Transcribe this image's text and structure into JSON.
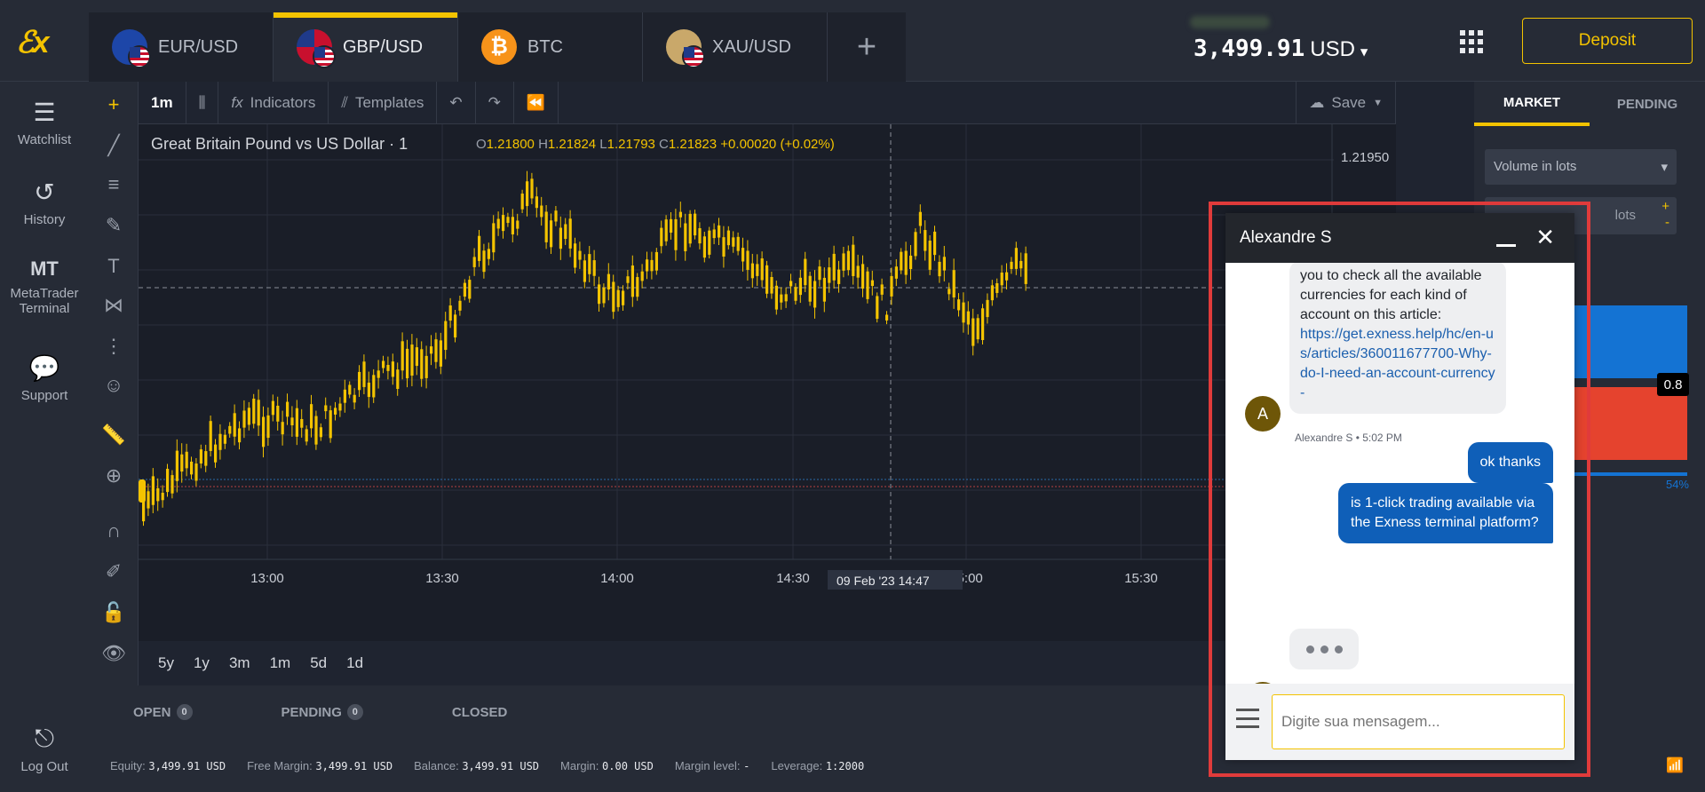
{
  "header": {
    "tabs": [
      {
        "label": "EUR/USD",
        "icon": "eur-usd-flag-icon"
      },
      {
        "label": "GBP/USD",
        "icon": "gbp-usd-flag-icon"
      },
      {
        "label": "BTC",
        "icon": "btc-icon"
      },
      {
        "label": "XAU/USD",
        "icon": "xau-usd-flag-icon"
      }
    ],
    "balance": "3,499.91",
    "currency": "USD",
    "deposit_label": "Deposit"
  },
  "leftnav": {
    "items": [
      {
        "label": "Watchlist"
      },
      {
        "label": "History"
      },
      {
        "label": "MetaTrader Terminal",
        "short": "MT"
      },
      {
        "label": "Support"
      }
    ],
    "logout_label": "Log Out"
  },
  "chart_toolbar": {
    "timeframe": "1m",
    "indicators_label": "Indicators",
    "templates_label": "Templates",
    "save_label": "Save"
  },
  "chart_header": {
    "title": "Great Britain Pound vs US Dollar",
    "interval": "1",
    "open": "1.21800",
    "high": "1.21824",
    "low": "1.21793",
    "close": "1.21823",
    "change": "+0.00020 (+0.02%)"
  },
  "chart_data": {
    "type": "candlestick",
    "x_ticks": [
      "13:00",
      "13:30",
      "14:00",
      "14:30",
      "15:00",
      "15:30"
    ],
    "crosshair_label": "09 Feb '23  14:47",
    "y_ticks": [
      "1.21950"
    ]
  },
  "timeframes": [
    "5y",
    "1y",
    "3m",
    "1m",
    "5d",
    "1d"
  ],
  "right_panel": {
    "tabs": [
      "MARKET",
      "PENDING"
    ],
    "volume_label": "Volume in lots",
    "lots_label": "lots",
    "spread": "0.8",
    "percent": "54%"
  },
  "bottom_tabs": [
    {
      "label": "OPEN",
      "count": "0"
    },
    {
      "label": "PENDING",
      "count": "0"
    },
    {
      "label": "CLOSED"
    }
  ],
  "status": {
    "equity_label": "Equity:",
    "equity": "3,499.91 USD",
    "free_margin_label": "Free Margin:",
    "free_margin": "3,499.91 USD",
    "balance_label": "Balance:",
    "balance": "3,499.91 USD",
    "margin_label": "Margin:",
    "margin": "0.00 USD",
    "margin_level_label": "Margin level:",
    "margin_level": "-",
    "leverage_label": "Leverage:",
    "leverage": "1:2000"
  },
  "chat": {
    "agent_name": "Alexandre S",
    "avatar_letter": "A",
    "agent_message_text": "you to check all the available currencies for each kind of account on this article:",
    "agent_message_link": "https://get.exness.help/hc/en-us/articles/360011677700-Why-do-I-need-an-account-currency-",
    "agent_meta": "Alexandre S • 5:02 PM",
    "user_messages": [
      "ok thanks",
      "is 1-click trading available via the Exness terminal platform?"
    ],
    "input_placeholder": "Digite sua mensagem..."
  }
}
